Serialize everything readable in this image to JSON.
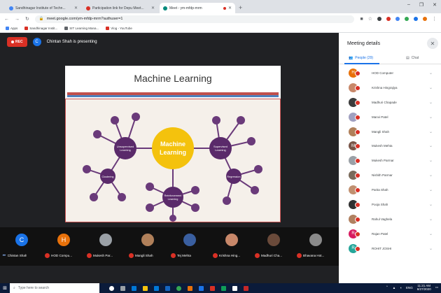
{
  "browser": {
    "tabs": [
      {
        "title": "Sandhinagar Institute of Techn...",
        "color": "#4285f4",
        "active": false
      },
      {
        "title": "Participation link for Depu Meet...",
        "color": "#d93025",
        "active": false
      },
      {
        "title": "Meet - ym-mfdp-mrm",
        "color": "#00897b",
        "active": true
      }
    ],
    "url": "meet.google.com/ym-mfdp-mrm?authuser=1",
    "bookmarks": [
      {
        "label": "Apps",
        "color": "#4285f4"
      },
      {
        "label": "Sandhinagar Instit...",
        "color": "#d93025"
      },
      {
        "label": "SIT Learning Mana...",
        "color": "#5f6368"
      },
      {
        "label": "Vlog - YouTube",
        "color": "#d93025"
      }
    ]
  },
  "meet": {
    "rec_label": "REC",
    "presenter_initial": "C",
    "presenter_text": "Chintan Shah is presenting",
    "slide_title": "Machine Learning",
    "slide_center_label": "Machine Learning",
    "slide_nodes": {
      "unsupervised": "Unsupervised Learning",
      "supervised": "Supervised Learning",
      "clustering": "Clustering",
      "regression": "Regression",
      "reinforcement": "Reinforcement Learning"
    },
    "filmstrip": [
      {
        "name": "Chintan Shah",
        "initial": "C",
        "color": "#1a73e8"
      },
      {
        "name": "HOD Compu...",
        "initial": "H",
        "color": "#e8710a"
      },
      {
        "name": "Mukesh Par...",
        "initial": "",
        "color": "#9aa0a6"
      },
      {
        "name": "Mangli Shah",
        "initial": "",
        "color": "#b0805a"
      },
      {
        "name": "Tej Mehta",
        "initial": "",
        "color": "#3a5fa0"
      },
      {
        "name": "Krishna Hing...",
        "initial": "",
        "color": "#c8886a"
      },
      {
        "name": "Madhuri Cha...",
        "initial": "",
        "color": "#6a4a3a"
      },
      {
        "name": "Bhavana Hot...",
        "initial": "",
        "color": "#8a8a8a"
      }
    ]
  },
  "panel": {
    "title": "Meeting details",
    "people_tab": "People (29)",
    "chat_tab": "Chat",
    "participants": [
      {
        "name": "HOD Computer",
        "initial": "H",
        "color": "#e8710a"
      },
      {
        "name": "Krishna Hingrajiya",
        "initial": "",
        "color": "#c8886a"
      },
      {
        "name": "Madhuri Chapade",
        "initial": "",
        "color": "#3c3c3c"
      },
      {
        "name": "Manvi Patel",
        "initial": "",
        "color": "#a0a0c0"
      },
      {
        "name": "Mangli Shah",
        "initial": "",
        "color": "#b0805a"
      },
      {
        "name": "Mukesh Mehta",
        "initial": "M",
        "color": "#795548"
      },
      {
        "name": "Mukesh Parmar",
        "initial": "",
        "color": "#9aa0a6"
      },
      {
        "name": "Nishith Parmar",
        "initial": "",
        "color": "#7a6a5a"
      },
      {
        "name": "Parita Shah",
        "initial": "",
        "color": "#c09070"
      },
      {
        "name": "Pooja Shah",
        "initial": "",
        "color": "#303030"
      },
      {
        "name": "Rahul Vaghela",
        "initial": "",
        "color": "#b08060"
      },
      {
        "name": "Rajan Patel",
        "initial": "R",
        "color": "#d81b60"
      },
      {
        "name": "ROHIT JOSHI",
        "initial": "R",
        "color": "#26a69a"
      }
    ]
  },
  "taskbar": {
    "search_placeholder": "Type here to search",
    "time": "11:21 AM",
    "date": "8/27/2020"
  }
}
